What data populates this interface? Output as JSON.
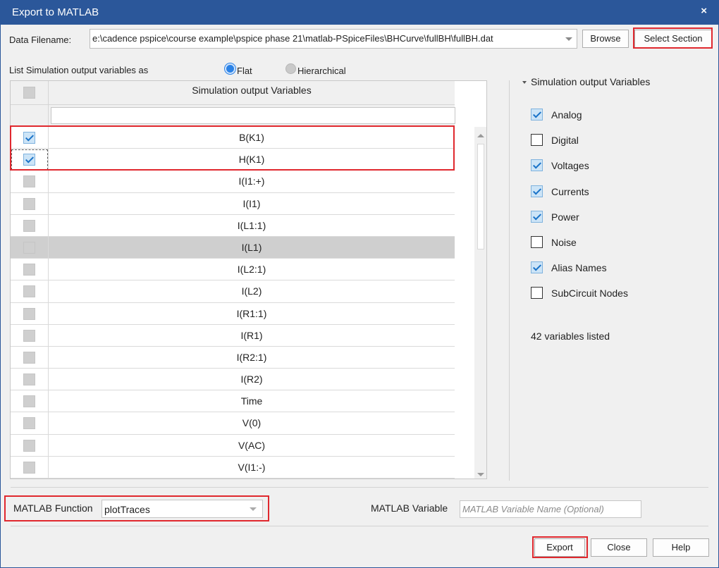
{
  "window": {
    "title": "Export to MATLAB",
    "close_glyph": "×"
  },
  "data_file": {
    "label": "Data Filename:",
    "value": "e:\\cadence pspice\\course example\\pspice phase 21\\matlab-PSpiceFiles\\BHCurve\\fullBH\\fullBH.dat"
  },
  "buttons": {
    "browse": "Browse",
    "select_section": "Select Section",
    "export": "Export",
    "close": "Close",
    "help": "Help"
  },
  "list_as": {
    "label": "List Simulation output variables as",
    "flat": "Flat",
    "hierarchical": "Hierarchical",
    "selected": "Flat"
  },
  "grid": {
    "header": "Simulation output Variables",
    "filter_value": "",
    "rows": [
      {
        "name": "B(K1)",
        "checked": true
      },
      {
        "name": "H(K1)",
        "checked": true
      },
      {
        "name": "I(I1:+)",
        "checked": false
      },
      {
        "name": "I(I1)",
        "checked": false
      },
      {
        "name": "I(L1:1)",
        "checked": false
      },
      {
        "name": "I(L1)",
        "checked": false,
        "selected": true
      },
      {
        "name": "I(L2:1)",
        "checked": false
      },
      {
        "name": "I(L2)",
        "checked": false
      },
      {
        "name": "I(R1:1)",
        "checked": false
      },
      {
        "name": "I(R1)",
        "checked": false
      },
      {
        "name": "I(R2:1)",
        "checked": false
      },
      {
        "name": "I(R2)",
        "checked": false
      },
      {
        "name": "Time",
        "checked": false
      },
      {
        "name": "V(0)",
        "checked": false
      },
      {
        "name": "V(AC)",
        "checked": false
      },
      {
        "name": "V(I1:-)",
        "checked": false
      }
    ]
  },
  "filters": {
    "title": "Simulation output Variables",
    "items": [
      {
        "label": "Analog",
        "checked": true
      },
      {
        "label": "Digital",
        "checked": false
      },
      {
        "label": "Voltages",
        "checked": true
      },
      {
        "label": "Currents",
        "checked": true
      },
      {
        "label": "Power",
        "checked": true
      },
      {
        "label": "Noise",
        "checked": false
      },
      {
        "label": "Alias Names",
        "checked": true
      },
      {
        "label": "SubCircuit Nodes",
        "checked": false
      }
    ],
    "count_text": "42 variables listed"
  },
  "matlab_function": {
    "label": "MATLAB Function",
    "value": "plotTraces"
  },
  "matlab_variable": {
    "label": "MATLAB Variable",
    "placeholder": "MATLAB Variable Name (Optional)"
  },
  "colors": {
    "title_bar": "#2b579a",
    "highlight": "#e0282e",
    "check": "#1a73c8"
  }
}
